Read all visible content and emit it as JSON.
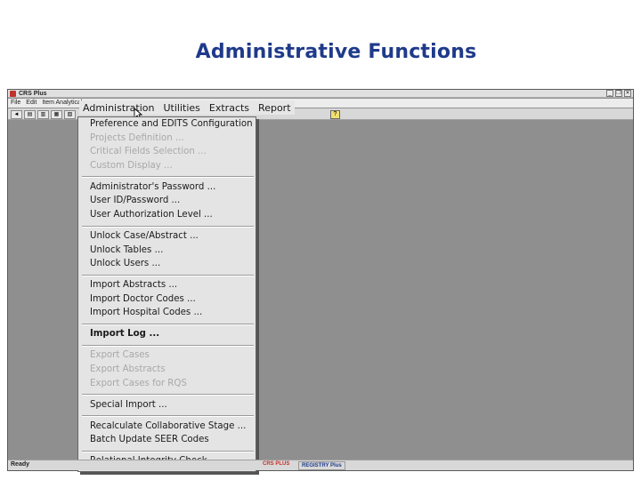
{
  "slide": {
    "title": "Administrative Functions"
  },
  "window": {
    "title": "CRS Plus",
    "controls": [
      "_",
      "❐",
      "✕"
    ]
  },
  "menubar": {
    "items": [
      "File",
      "Edit",
      "Item Analytical"
    ]
  },
  "toolbar": {
    "help_glyph": "?"
  },
  "topmenu": {
    "items": [
      "Administration",
      "Utilities",
      "Extracts",
      "Report"
    ]
  },
  "dropdown": {
    "groups": [
      [
        {
          "label": "Preference and EDITS Configuration",
          "enabled": true
        },
        {
          "label": "Projects Definition ...",
          "enabled": false
        },
        {
          "label": "Critical Fields Selection ...",
          "enabled": false
        },
        {
          "label": "Custom Display ...",
          "enabled": false
        }
      ],
      [
        {
          "label": "Administrator's Password ...",
          "enabled": true
        },
        {
          "label": "User ID/Password ...",
          "enabled": true
        },
        {
          "label": "User Authorization Level ...",
          "enabled": true
        }
      ],
      [
        {
          "label": "Unlock Case/Abstract ...",
          "enabled": true
        },
        {
          "label": "Unlock Tables ...",
          "enabled": true
        },
        {
          "label": "Unlock Users ...",
          "enabled": true
        }
      ],
      [
        {
          "label": "Import Abstracts ...",
          "enabled": true
        },
        {
          "label": "Import Doctor Codes ...",
          "enabled": true
        },
        {
          "label": "Import Hospital Codes ...",
          "enabled": true
        }
      ],
      [
        {
          "label": "Import Log ...",
          "enabled": true
        }
      ],
      [
        {
          "label": "Export Cases",
          "enabled": false
        },
        {
          "label": "Export Abstracts",
          "enabled": false
        },
        {
          "label": "Export Cases for RQS",
          "enabled": false
        }
      ],
      [
        {
          "label": "Special Import ...",
          "enabled": true
        }
      ],
      [
        {
          "label": "Recalculate Collaborative Stage ...",
          "enabled": true
        },
        {
          "label": "Batch Update SEER Codes",
          "enabled": true
        }
      ],
      [
        {
          "label": "Relational Integrity Check ...",
          "enabled": true
        }
      ]
    ]
  },
  "statusbar": {
    "text": "Ready",
    "crs_label": "CRS PLUS",
    "registry_label": "REGISTRY Plus"
  },
  "colors": {
    "title": "#1f3a8a",
    "workspace": "#8f8f8f",
    "menu_bg": "#e4e4e4",
    "disabled_text": "#a8a8a8"
  }
}
